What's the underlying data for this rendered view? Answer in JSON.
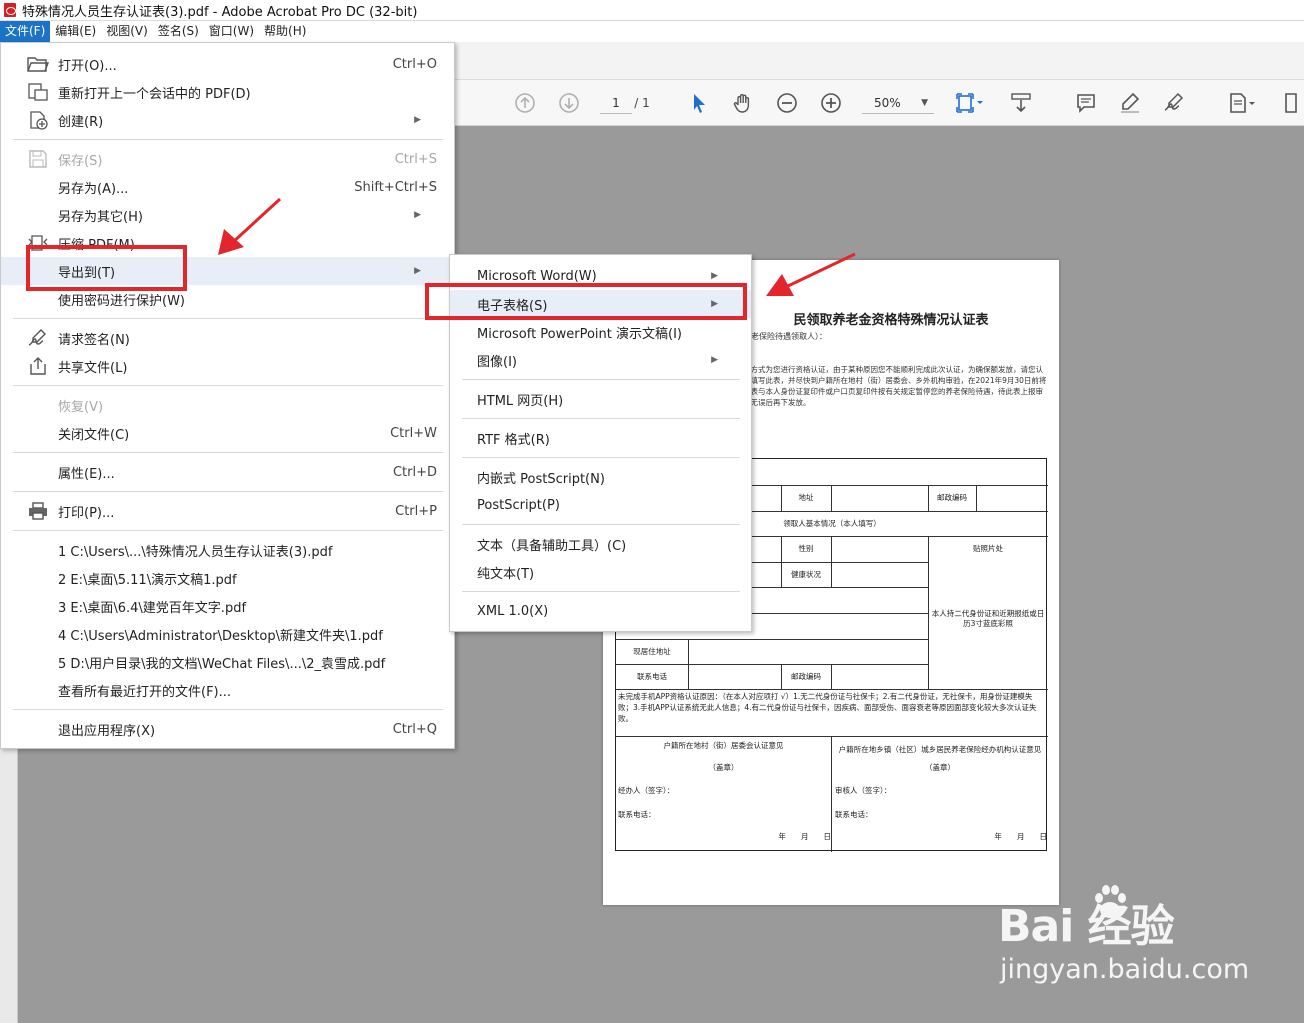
{
  "window": {
    "title": "特殊情况人员生存认证表(3).pdf - Adobe Acrobat Pro DC (32-bit)"
  },
  "menubar": [
    "文件(F)",
    "编辑(E)",
    "视图(V)",
    "签名(S)",
    "窗口(W)",
    "帮助(H)"
  ],
  "toolbar": {
    "page_current": "1",
    "page_total": "/ 1",
    "zoom": "50%"
  },
  "file_menu": {
    "items": [
      {
        "label": "打开(O)...",
        "shortcut": "Ctrl+O",
        "icon": "open-folder-icon"
      },
      {
        "label": "重新打开上一个会话中的 PDF(D)",
        "shortcut": "",
        "icon": "reopen-icon"
      },
      {
        "label": "创建(R)",
        "shortcut": "",
        "icon": "create-icon",
        "submenu": true
      },
      {
        "label": "保存(S)",
        "shortcut": "Ctrl+S",
        "icon": "save-icon",
        "disabled": true
      },
      {
        "label": "另存为(A)...",
        "shortcut": "Shift+Ctrl+S"
      },
      {
        "label": "另存为其它(H)",
        "shortcut": "",
        "submenu": true
      },
      {
        "label": "压缩 PDF(M)",
        "shortcut": "",
        "icon": "compress-icon"
      },
      {
        "label": "导出到(T)",
        "shortcut": "",
        "submenu": true,
        "highlighted": true
      },
      {
        "label": "使用密码进行保护(W)",
        "shortcut": ""
      },
      {
        "label": "请求签名(N)",
        "shortcut": "",
        "icon": "request-sign-icon"
      },
      {
        "label": "共享文件(L)",
        "shortcut": "",
        "icon": "share-icon"
      },
      {
        "label": "恢复(V)",
        "shortcut": "",
        "disabled": true
      },
      {
        "label": "关闭文件(C)",
        "shortcut": "Ctrl+W"
      },
      {
        "label": "属性(E)...",
        "shortcut": "Ctrl+D"
      },
      {
        "label": "打印(P)...",
        "shortcut": "Ctrl+P",
        "icon": "print-icon"
      },
      {
        "label": "1 C:\\Users\\...\\特殊情况人员生存认证表(3).pdf",
        "shortcut": ""
      },
      {
        "label": "2 E:\\桌面\\5.11\\演示文稿1.pdf",
        "shortcut": ""
      },
      {
        "label": "3 E:\\桌面\\6.4\\建党百年文字.pdf",
        "shortcut": ""
      },
      {
        "label": "4 C:\\Users\\Administrator\\Desktop\\新建文件夹\\1.pdf",
        "shortcut": ""
      },
      {
        "label": "5 D:\\用户目录\\我的文档\\WeChat Files\\...\\2_袁雪成.pdf",
        "shortcut": ""
      },
      {
        "label": "查看所有最近打开的文件(F)...",
        "shortcut": ""
      },
      {
        "label": "退出应用程序(X)",
        "shortcut": "Ctrl+Q"
      }
    ]
  },
  "export_submenu": {
    "items": [
      {
        "label": "Microsoft Word(W)",
        "submenu": true
      },
      {
        "label": "电子表格(S)",
        "submenu": true,
        "highlighted": true
      },
      {
        "label": "Microsoft PowerPoint 演示文稿(I)",
        "submenu": false
      },
      {
        "label": "图像(I)",
        "submenu": true
      },
      {
        "label": "HTML 网页(H)",
        "submenu": false
      },
      {
        "label": "RTF 格式(R)",
        "submenu": false
      },
      {
        "label": "内嵌式 PostScript(N)",
        "submenu": false
      },
      {
        "label": "PostScript(P)",
        "submenu": false
      },
      {
        "label": "文本（具备辅助工具）(C)",
        "submenu": false
      },
      {
        "label": "纯文本(T)",
        "submenu": false
      },
      {
        "label": "XML 1.0(X)",
        "submenu": false
      }
    ]
  },
  "document": {
    "title": "民领取养老金资格特殊情况认证表",
    "subtitle": "养老保险待遇领取人）：",
    "paragraph": "别方式为您进行资格认证，由于某种原因您不能顺利完成此次认证，为确保额发放，请您认真填写此表，并尽快到户籍所在地村（街）居委会、乡外机构审验，在2021年9月30日前将此表与本人身份证复印件或户口页复印件按有关规定暂停您的养老保险待遇，待此表上报审核无误后再下发放。",
    "cells": {
      "address": "地址",
      "postal1": "邮政编码",
      "basic_info": "领取人基本情况（本人填写）",
      "gender": "性别",
      "photo": "贴照片处",
      "health": "健康状况",
      "photo_note": "本人持二代身份证和近期报纸或日历3寸蓝底彩照",
      "residence": "现居住地址",
      "phone": "联系电话",
      "postal2": "邮政编码",
      "reason": "未完成手机APP资格认证原因：（在本人对应项打 √）1.无二代身份证与社保卡；2.有二代身份证，无社保卡，用身份证建模失败；3.手机APP认证系统无此人信息；4.有二代身份证与社保卡，因疾病、面部受伤、面容衰老等原因面部变化较大多次认证失败。",
      "left_opinion": "户籍所在地村（街）居委会认证意见",
      "right_opinion": "户籍所在地乡镇（社区）城乡居民养老保险经办机构认证意见",
      "seal_left": "（盖章）",
      "seal_right": "（盖章）",
      "handler": "经办人（签字）：",
      "reviewer": "审核人（签字）：",
      "tel_left": "联系电话：",
      "tel_right": "联系电话：",
      "date_left": "年　　月　　日",
      "date_right": "年　　月　　日"
    }
  },
  "watermark": {
    "brand": "Bai  经验",
    "url": "jingyan.baidu.com"
  }
}
